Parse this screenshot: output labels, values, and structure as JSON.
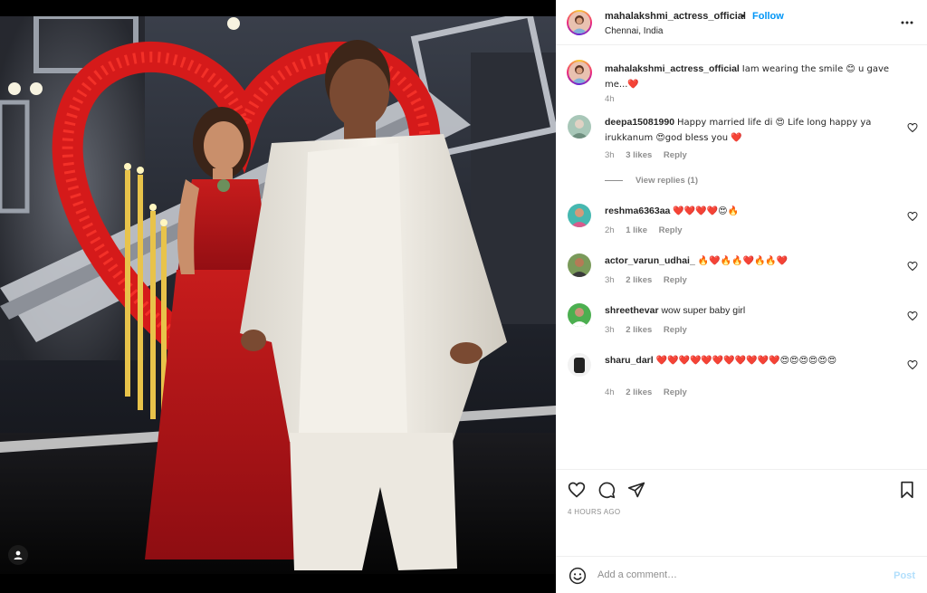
{
  "post": {
    "username": "mahalakshmi_actress_official",
    "dot": "•",
    "follow_label": "Follow",
    "location": "Chennai, India"
  },
  "caption": {
    "username": "mahalakshmi_actress_official",
    "text": "Iam wearing the smile 😊 u gave me...❤️",
    "time": "4h"
  },
  "comments": [
    {
      "username": "deepa15081990",
      "text": "Happy married life di 😍 Life long happy ya irukkanum 😍god bless you ❤️",
      "time": "3h",
      "likes": "3 likes",
      "reply": "Reply",
      "view_replies": "View replies (1)"
    },
    {
      "username": "reshma6363aa",
      "text": "❤️❤️❤️❤️😍🔥",
      "time": "2h",
      "likes": "1 like",
      "reply": "Reply"
    },
    {
      "username": "actor_varun_udhai_",
      "text": "🔥❤️🔥🔥❤️🔥🔥❤️",
      "time": "3h",
      "likes": "2 likes",
      "reply": "Reply"
    },
    {
      "username": "shreethevar",
      "text": "wow super baby girl",
      "time": "3h",
      "likes": "2 likes",
      "reply": "Reply"
    },
    {
      "username": "sharu_darl",
      "text": "❤️❤️❤️❤️❤️❤️❤️❤️❤️❤️❤️😍😍😍😍😍😍",
      "time": "4h",
      "likes": "2 likes",
      "reply": "Reply"
    }
  ],
  "actions": {
    "time_ago": "4 HOURS AGO"
  },
  "add_comment": {
    "placeholder": "Add a comment…",
    "post_label": "Post"
  },
  "colors": {
    "accent": "#0095f6",
    "muted": "#8e8e8e",
    "text": "#262626",
    "post_disabled": "#b2dffc"
  }
}
